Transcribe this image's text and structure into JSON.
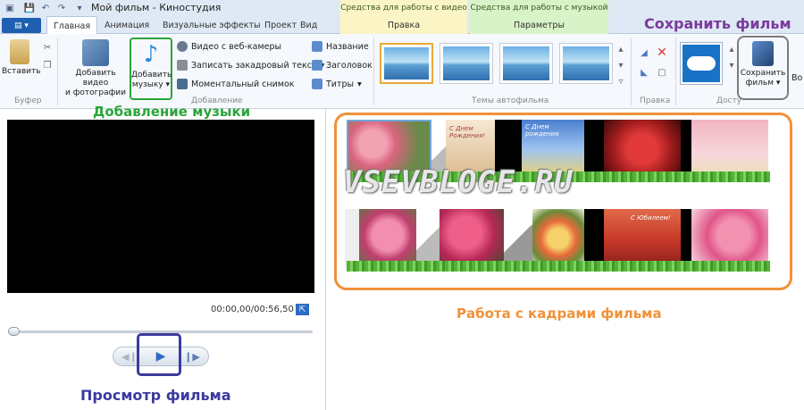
{
  "titlebar": {
    "title": "Мой фильм - Киностудия",
    "context_video": "Средства для работы с видео",
    "context_music": "Средства для работы с музыкой"
  },
  "tabs": {
    "home": "Главная",
    "animation": "Анимация",
    "effects": "Визуальные эффекты",
    "project": "Проект",
    "view": "Вид",
    "edit": "Правка",
    "params": "Параметры"
  },
  "ribbon": {
    "paste": "Вставить",
    "clipboard_group": "Буфер",
    "add_video_l1": "Добавить видео",
    "add_video_l2": "и фотографии",
    "add_music_l1": "Добавить",
    "add_music_l2": "музыку",
    "webcam": "Видео с веб-камеры",
    "narration": "Записать закадровый текст",
    "snapshot": "Моментальный снимок",
    "title": "Название",
    "caption": "Заголовок",
    "credits": "Титры",
    "add_group": "Добавление",
    "themes_group": "Темы автофильма",
    "edit_group": "Правка",
    "access_group": "Досту",
    "save_l1": "Сохранить",
    "save_l2": "фильм",
    "more": "Во"
  },
  "annotations": {
    "save_movie": "Сохранить фильм",
    "add_music": "Добавление музыки",
    "frames": "Работа с кадрами фильма",
    "preview": "Просмотр фильма"
  },
  "player": {
    "timecode": "00:00,00/00:56,50",
    "progress": 0.0
  },
  "storyboard": {
    "watermark": "VSEVBLOGE.RU",
    "row1_labels": [
      "",
      "С Днем Рождения!",
      "С Днем рождения",
      "",
      ""
    ],
    "row2_labels": [
      "",
      "",
      "",
      "С Юбилеем!",
      ""
    ]
  },
  "colors": {
    "green_anno": "#2aa53a",
    "purple_anno": "#7a3b9c",
    "orange_anno": "#f0913a",
    "blue_anno": "#3b3b9e"
  }
}
